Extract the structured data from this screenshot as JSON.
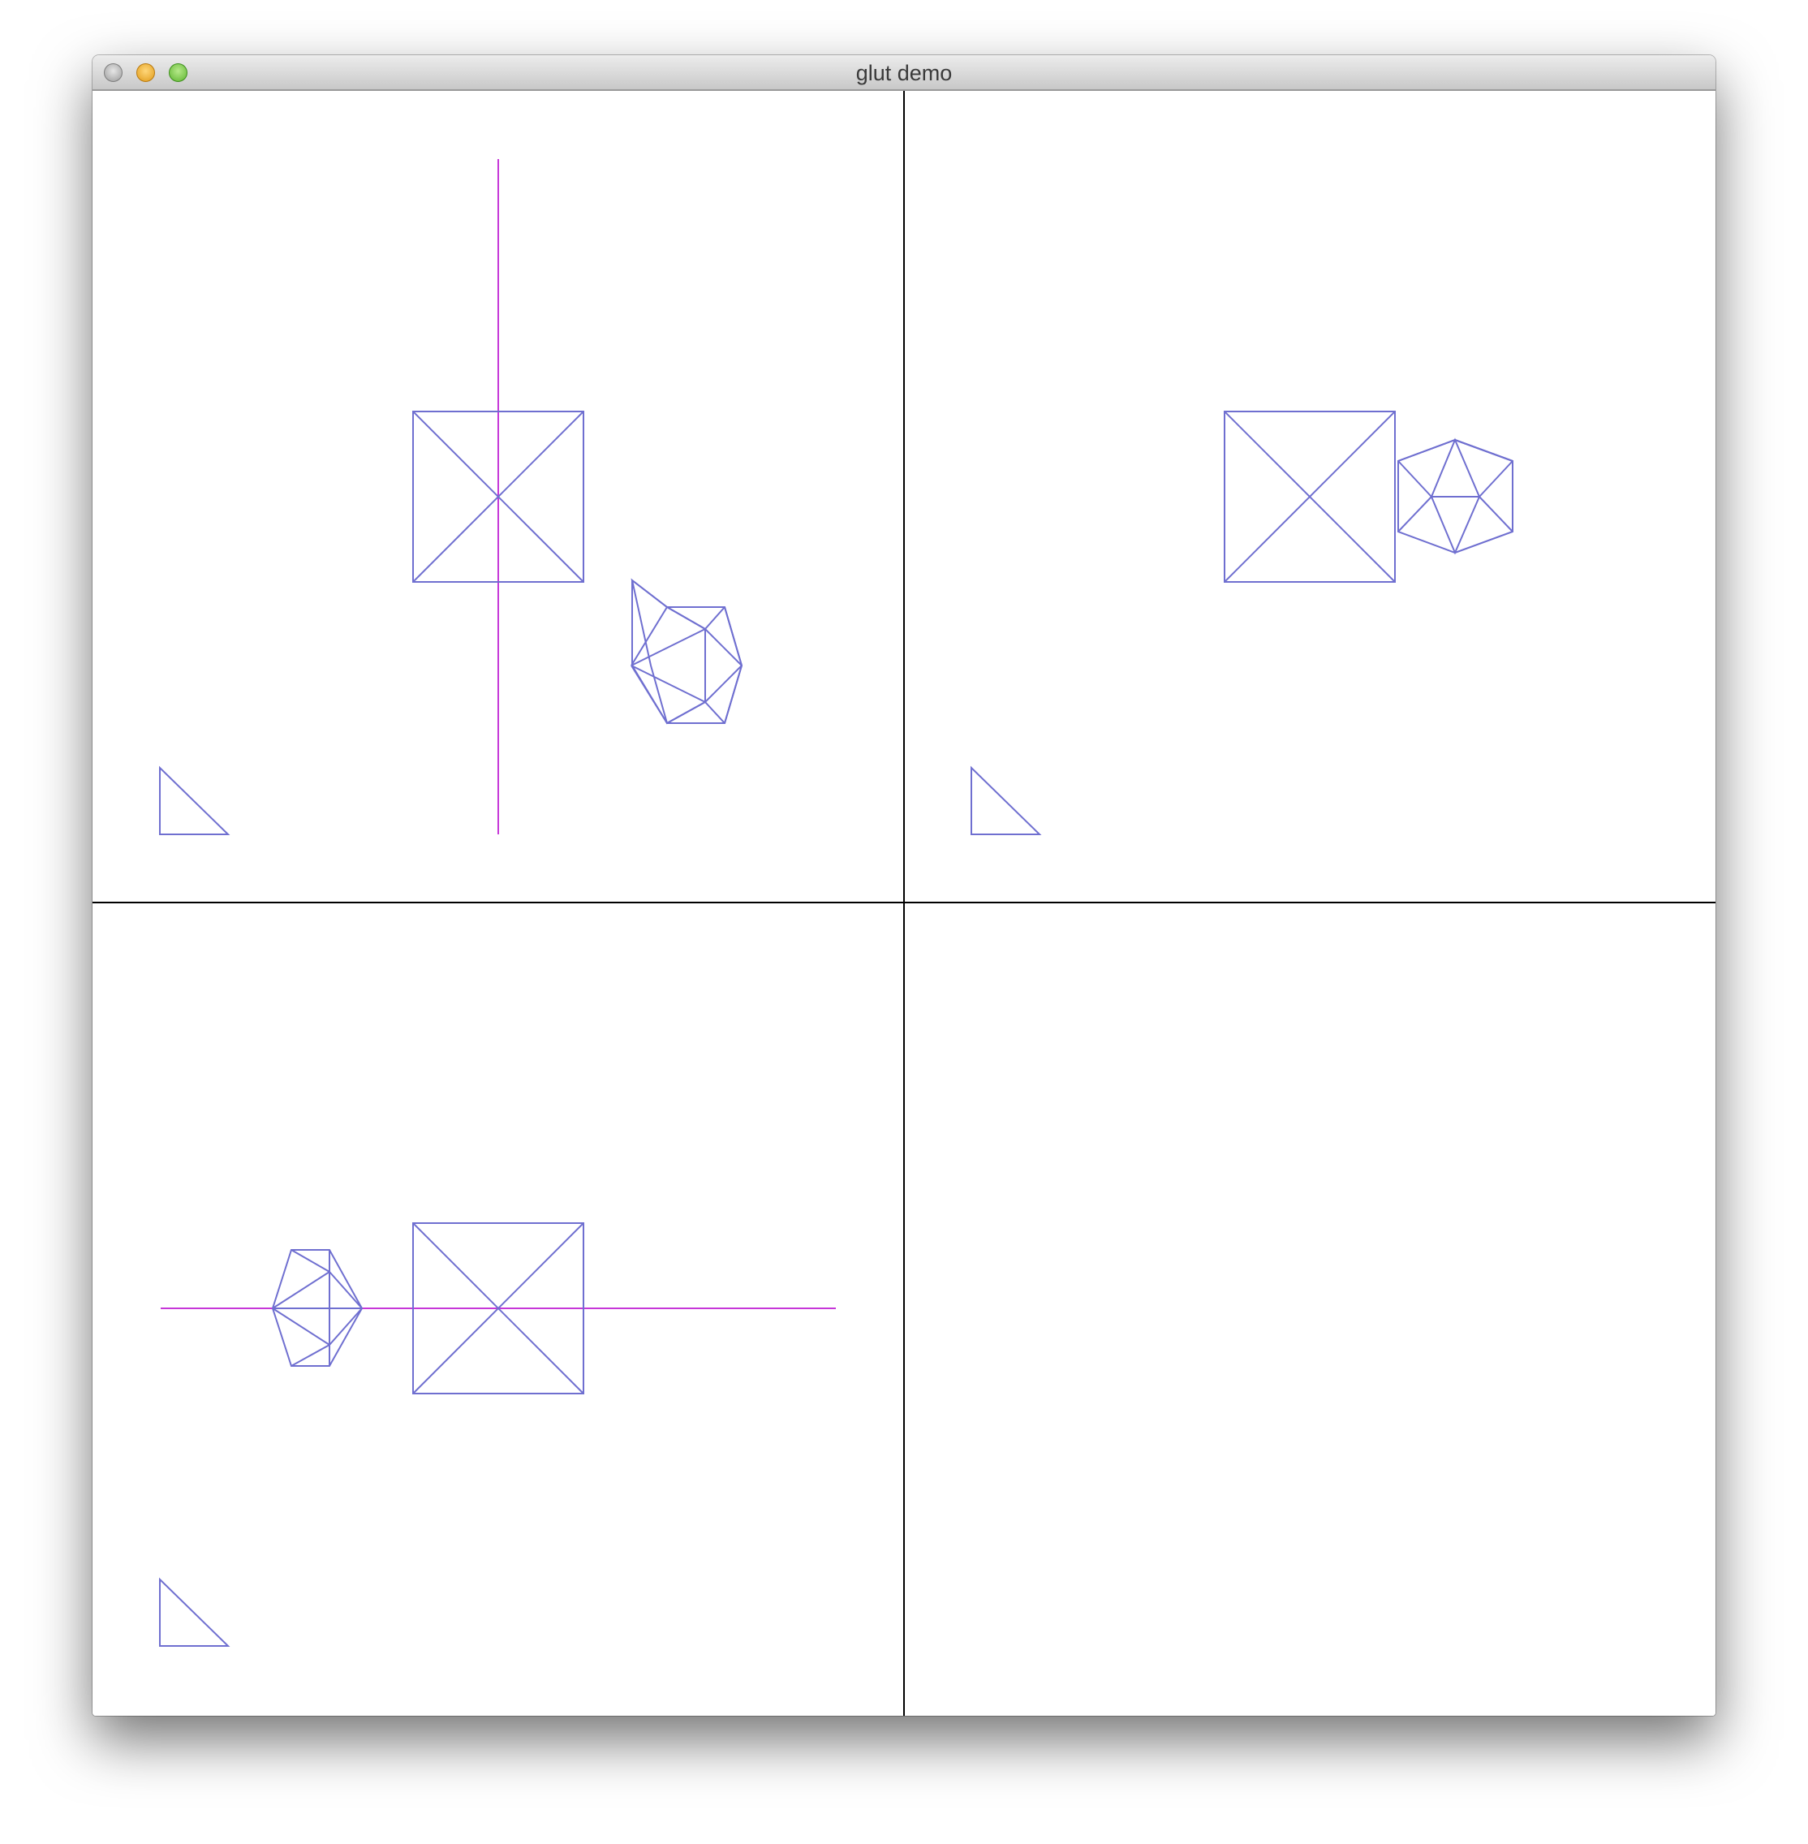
{
  "window": {
    "title": "glut demo"
  },
  "colors": {
    "wireframe": "#6f6fd0",
    "axis": "#c637d8",
    "divider": "#000000"
  },
  "viewports": [
    {
      "name": "front-view",
      "objects": [
        "cube",
        "icosahedron",
        "triangle",
        "vertical-axis"
      ]
    },
    {
      "name": "top-view",
      "objects": [
        "cube",
        "icosahedron",
        "triangle"
      ]
    },
    {
      "name": "side-view",
      "objects": [
        "cube",
        "icosahedron",
        "triangle",
        "horizontal-axis"
      ]
    },
    {
      "name": "empty-view",
      "objects": []
    }
  ]
}
